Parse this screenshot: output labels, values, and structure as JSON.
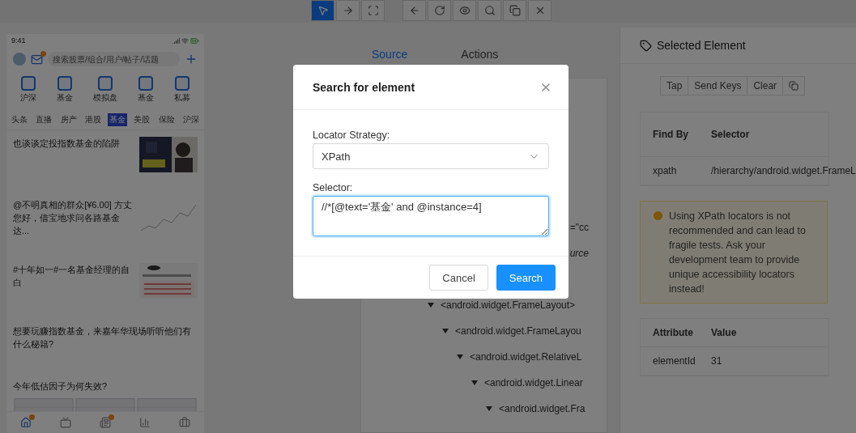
{
  "toolbar": {
    "groups": [
      [
        {
          "selected": true
        },
        {
          "selected": false
        },
        {
          "selected": false
        }
      ],
      [
        {
          "selected": false
        },
        {
          "selected": false
        },
        {
          "selected": false
        },
        {
          "selected": false
        },
        {
          "selected": false
        },
        {
          "selected": false
        }
      ]
    ]
  },
  "phone": {
    "status_time": "9:41",
    "mail_badge": true,
    "search_placeholder": "搜索股票/组合/用户/帖子/话题",
    "shortcuts": [
      "沪深",
      "基金",
      "模拟盘",
      "基金",
      "私募"
    ],
    "tabs": [
      {
        "label": "头条",
        "selected": false
      },
      {
        "label": "直播",
        "selected": false
      },
      {
        "label": "房产",
        "selected": false
      },
      {
        "label": "港股",
        "selected": false
      },
      {
        "label": "基金",
        "selected": true
      },
      {
        "label": "美股",
        "selected": false
      },
      {
        "label": "保险",
        "selected": false
      },
      {
        "label": "沪深",
        "selected": false
      }
    ],
    "articles": [
      {
        "kind": "thumb",
        "title": "也谈谈定投指数基金的陷阱"
      },
      {
        "kind": "chart",
        "title": "@不明真相的群众[¥6.00] 方丈您好，借宝地求问各路基金达..."
      },
      {
        "kind": "thumb",
        "title": "#十年如一#一名基金经理的自白"
      },
      {
        "kind": "text",
        "title": "想要玩赚指数基金，来嘉年华现场听听他们有什么秘籍?"
      },
      {
        "kind": "wide",
        "title": "今年低估因子为何失效?"
      }
    ],
    "nav": [
      {
        "selected": true,
        "badge": true
      },
      {
        "selected": false,
        "badge": false
      },
      {
        "selected": false,
        "badge": true
      },
      {
        "selected": false,
        "badge": false
      },
      {
        "selected": false,
        "badge": false
      }
    ]
  },
  "inspector_tabs": [
    {
      "label": "Source",
      "selected": true
    },
    {
      "label": "Actions",
      "selected": false
    }
  ],
  "source": {
    "fragments": [
      {
        "text": "=\"cc",
        "italic": false
      },
      {
        "text": "urce",
        "italic": true
      }
    ],
    "tree": [
      {
        "label": "<android.widget.FrameLayout>",
        "expanded": true,
        "children": [
          {
            "label": "<android.widget.FrameLayou",
            "expanded": true,
            "children": [
              {
                "label": "<android.widget.RelativeL",
                "expanded": true,
                "children": [
                  {
                    "label": "<android.widget.Linear",
                    "expanded": true,
                    "children": [
                      {
                        "label": "<android.widget.Fra",
                        "expanded": true
                      }
                    ]
                  }
                ]
              }
            ]
          }
        ]
      }
    ]
  },
  "selected_element": {
    "title": "Selected Element",
    "actions": [
      "Tap",
      "Send Keys",
      "Clear"
    ],
    "find_table": {
      "columns": [
        "Find By",
        "Selector"
      ],
      "rows": [
        [
          "xpath",
          "/hierarchy/android.widget.FrameL"
        ]
      ]
    },
    "warning": "Using XPath locators is not recommended and can lead to fragile tests. Ask your development team to provide unique accessibility locators instead!",
    "attr_table": {
      "columns": [
        "Attribute",
        "Value"
      ],
      "rows": [
        [
          "elementId",
          "31"
        ]
      ]
    }
  },
  "modal": {
    "title": "Search for element",
    "strategy_label": "Locator Strategy:",
    "strategy_value": "XPath",
    "selector_label": "Selector:",
    "selector_value": "//*[@text='基金' and @instance=4]",
    "buttons": [
      {
        "label": "Cancel",
        "primary": false
      },
      {
        "label": "Search",
        "primary": true
      }
    ]
  }
}
